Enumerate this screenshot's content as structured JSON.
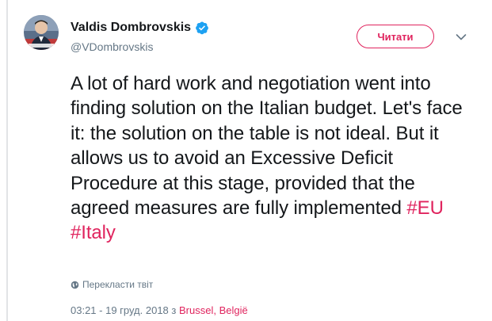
{
  "author": {
    "name": "Valdis Dombrovskis",
    "handle": "@VDombrovskis",
    "avatar_icon": "profile-photo"
  },
  "follow_button": {
    "label": "Читати"
  },
  "tweet": {
    "text_parts": [
      "A lot of hard work and negotiation went into finding solution on the Italian budget. Let's face it: the solution on the table is not ideal. But it allows us to avoid an Excessive Deficit Procedure at this stage, provided that the agreed measures are fully implemented "
    ],
    "hashtags": [
      "#EU",
      "#Italy"
    ]
  },
  "translate": {
    "label": "Перекласти твіт"
  },
  "meta": {
    "time": "03:21 - 19 груд. 2018",
    "separator": "з",
    "location": "Brussel, België"
  },
  "colors": {
    "accent": "#e0245e",
    "verified": "#1da1f2",
    "muted": "#657786",
    "text": "#14171a"
  }
}
